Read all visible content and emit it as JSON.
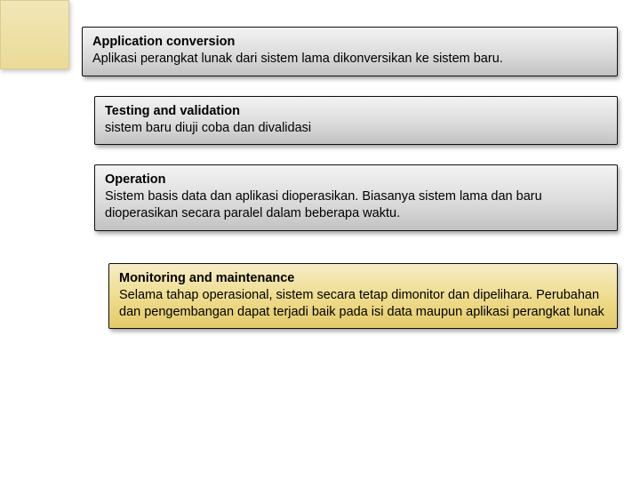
{
  "card1": {
    "title": "Application conversion",
    "body": "Aplikasi perangkat lunak dari sistem lama  dikonversikan ke sistem baru."
  },
  "card2": {
    "title": "Testing and validation",
    "body": "sistem baru diuji coba dan divalidasi"
  },
  "card3": {
    "title": "Operation",
    "body": "Sistem basis data dan aplikasi dioperasikan. Biasanya sistem lama dan baru dioperasikan secara paralel dalam beberapa waktu."
  },
  "card4": {
    "title": "Monitoring and maintenance",
    "body": "Selama tahap operasional, sistem secara tetap dimonitor dan dipelihara. Perubahan dan pengembangan dapat terjadi baik pada isi data maupun aplikasi perangkat lunak"
  }
}
